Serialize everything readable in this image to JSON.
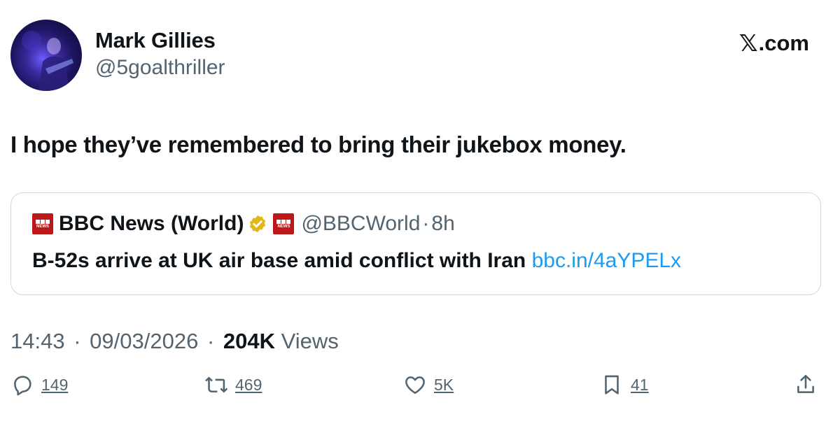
{
  "author": {
    "display_name": "Mark Gillies",
    "handle": "@5goalthriller"
  },
  "brand": {
    "x_symbol": "𝕏",
    "domain": ".com"
  },
  "tweet": {
    "text": "I hope they’ve remembered to bring their jukebox money."
  },
  "quote": {
    "name": "BBC News (World)",
    "logo_text": "NEWS",
    "handle": "@BBCWorld",
    "separator": "·",
    "age": "8h",
    "text": "B-52s arrive at UK air base amid conflict with Iran ",
    "link": "bbc.in/4aYPELx",
    "verified_color": "#e2b719"
  },
  "meta": {
    "time": "14:43",
    "sep1": "·",
    "date": "09/03/2026",
    "sep2": "·",
    "views_count": "204K",
    "views_label": "Views"
  },
  "actions": {
    "replies": "149",
    "reposts": "469",
    "likes": "5K",
    "bookmarks": "41"
  },
  "colors": {
    "text": "#0f1419",
    "secondary": "#536471",
    "link": "#1d9bf0",
    "border": "#cfd9de",
    "bbc_red": "#bb1919"
  }
}
